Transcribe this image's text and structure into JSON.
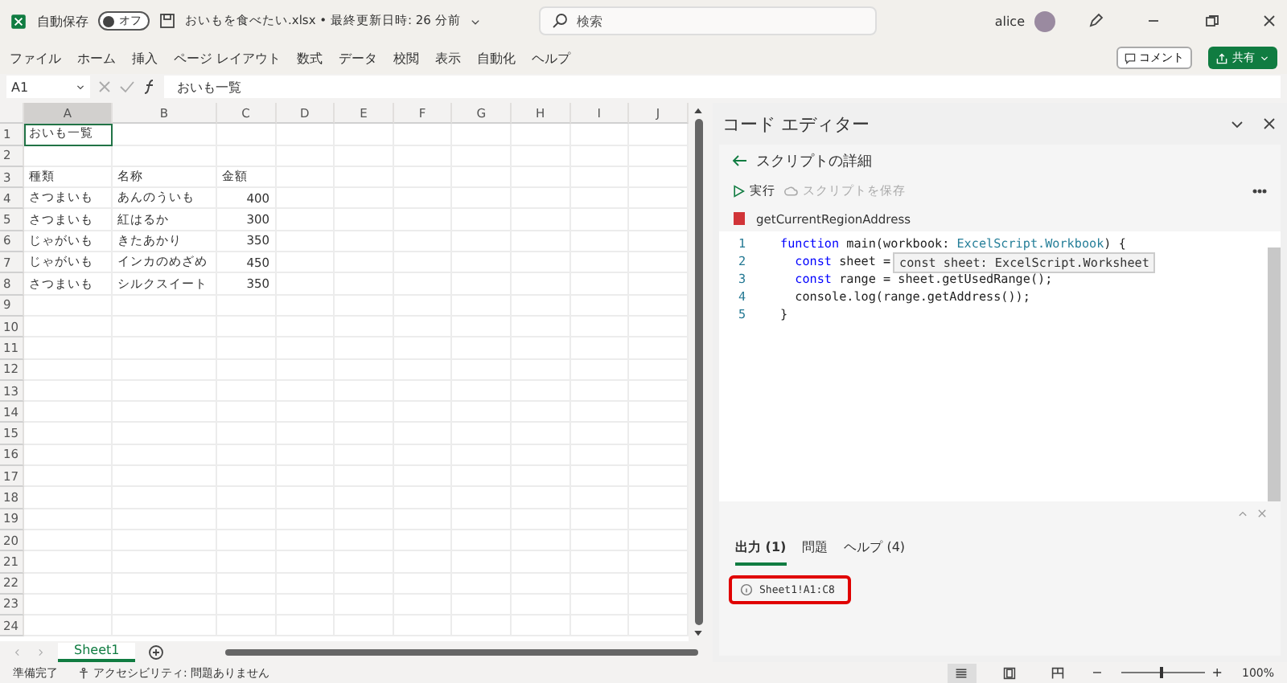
{
  "title_bar": {
    "autosave_label": "自動保存",
    "autosave_toggle": {
      "label": "オフ",
      "on": false
    },
    "file_title": "おいもを食べたい.xlsx • 最終更新日時: 26 分前",
    "search": {
      "placeholder": "検索"
    },
    "user": "alice"
  },
  "menu": [
    {
      "label": "ファイル"
    },
    {
      "label": "ホーム"
    },
    {
      "label": "挿入"
    },
    {
      "label": "ページ レイアウト"
    },
    {
      "label": "数式"
    },
    {
      "label": "データ"
    },
    {
      "label": "校閲"
    },
    {
      "label": "表示"
    },
    {
      "label": "自動化"
    },
    {
      "label": "ヘルプ"
    }
  ],
  "menu_buttons": {
    "comment": "コメント",
    "share": "共有"
  },
  "formula_bar": {
    "name_box": "A1",
    "value": "おいも一覧"
  },
  "sheet": {
    "columns": [
      "A",
      "B",
      "C",
      "D",
      "E",
      "F",
      "G",
      "H",
      "I",
      "J"
    ],
    "rows": [
      {
        "number": "1",
        "cells": [
          {
            "text": "おいも一覧",
            "kind": "text",
            "selected": true
          }
        ]
      },
      {
        "number": "2"
      },
      {
        "number": "3",
        "cells": [
          {
            "text": "種類",
            "kind": "text",
            "selected": false
          },
          {
            "text": "名称",
            "kind": "text",
            "selected": false
          },
          {
            "text": "金額",
            "kind": "text",
            "selected": false
          }
        ]
      },
      {
        "number": "4",
        "cells": [
          {
            "text": "さつまいも",
            "kind": "text",
            "selected": false
          },
          {
            "text": "あんのういも",
            "kind": "text",
            "selected": false
          },
          {
            "text": "400",
            "kind": "number",
            "selected": false
          }
        ]
      },
      {
        "number": "5",
        "cells": [
          {
            "text": "さつまいも",
            "kind": "text",
            "selected": false
          },
          {
            "text": "紅はるか",
            "kind": "text",
            "selected": false
          },
          {
            "text": "300",
            "kind": "number",
            "selected": false
          }
        ]
      },
      {
        "number": "6",
        "cells": [
          {
            "text": "じゃがいも",
            "kind": "text",
            "selected": false
          },
          {
            "text": "きたあかり",
            "kind": "text",
            "selected": false
          },
          {
            "text": "350",
            "kind": "number",
            "selected": false
          }
        ]
      },
      {
        "number": "7",
        "cells": [
          {
            "text": "じゃがいも",
            "kind": "text",
            "selected": false
          },
          {
            "text": "インカのめざめ",
            "kind": "text",
            "selected": false
          },
          {
            "text": "450",
            "kind": "number",
            "selected": false
          }
        ]
      },
      {
        "number": "8",
        "cells": [
          {
            "text": "さつまいも",
            "kind": "text",
            "selected": false
          },
          {
            "text": "シルクスイート",
            "kind": "text",
            "selected": false
          },
          {
            "text": "350",
            "kind": "number",
            "selected": false
          }
        ]
      },
      {
        "number": "9"
      },
      {
        "number": "10"
      },
      {
        "number": "11"
      },
      {
        "number": "12"
      },
      {
        "number": "13"
      },
      {
        "number": "14"
      },
      {
        "number": "15"
      },
      {
        "number": "16"
      },
      {
        "number": "17"
      },
      {
        "number": "18"
      },
      {
        "number": "19"
      },
      {
        "number": "20"
      },
      {
        "number": "21"
      },
      {
        "number": "22"
      },
      {
        "number": "23"
      },
      {
        "number": "24"
      }
    ]
  },
  "sheet_tabs": [
    {
      "label": "Sheet1",
      "selected": true
    }
  ],
  "code_editor": {
    "title": "コード エディター",
    "subtitle": "スクリプトの詳細",
    "actions": [
      {
        "label": "実行",
        "disabled": false,
        "kind": "run"
      },
      {
        "label": "スクリプトを保存",
        "disabled": true,
        "kind": "save"
      }
    ],
    "script_name": "getCurrentRegionAddress",
    "lines": [
      {
        "number": "1",
        "tokens": [
          {
            "text": "function",
            "kind": "keyword"
          },
          {
            "text": " main(workbook: ",
            "kind": "plain"
          },
          {
            "text": "ExcelScript.Workbook",
            "kind": "type"
          },
          {
            "text": ") {",
            "kind": "plain"
          }
        ]
      },
      {
        "number": "2",
        "tokens": [
          {
            "text": "  const",
            "kind": "keyword"
          },
          {
            "text": " sheet =",
            "kind": "plain"
          }
        ]
      },
      {
        "number": "3",
        "tokens": [
          {
            "text": "  const",
            "kind": "keyword"
          },
          {
            "text": " range = sheet.getUsedRange();",
            "kind": "plain"
          }
        ]
      },
      {
        "number": "4",
        "tokens": [
          {
            "text": "  console.log(range.getAddress());",
            "kind": "plain"
          }
        ]
      },
      {
        "number": "5",
        "tokens": [
          {
            "text": "}",
            "kind": "plain"
          }
        ]
      }
    ],
    "tooltip": "const sheet: ExcelScript.Worksheet",
    "output_tabs": [
      {
        "label": "出力 (1)",
        "selected": true
      },
      {
        "label": "問題",
        "selected": false
      },
      {
        "label": "ヘルプ (4)",
        "selected": false
      }
    ],
    "output": [
      {
        "text": "Sheet1!A1:C8",
        "highlighted": true
      }
    ]
  },
  "status_bar": {
    "ready": "準備完了",
    "accessibility": "アクセシビリティ: 問題ありません",
    "views": [
      {
        "kind": "normal",
        "selected": true
      },
      {
        "kind": "layout",
        "selected": false
      },
      {
        "kind": "pagebreak",
        "selected": false
      }
    ],
    "zoom": {
      "out": "−",
      "in": "+",
      "level": 0.5,
      "reading": "100%"
    }
  }
}
